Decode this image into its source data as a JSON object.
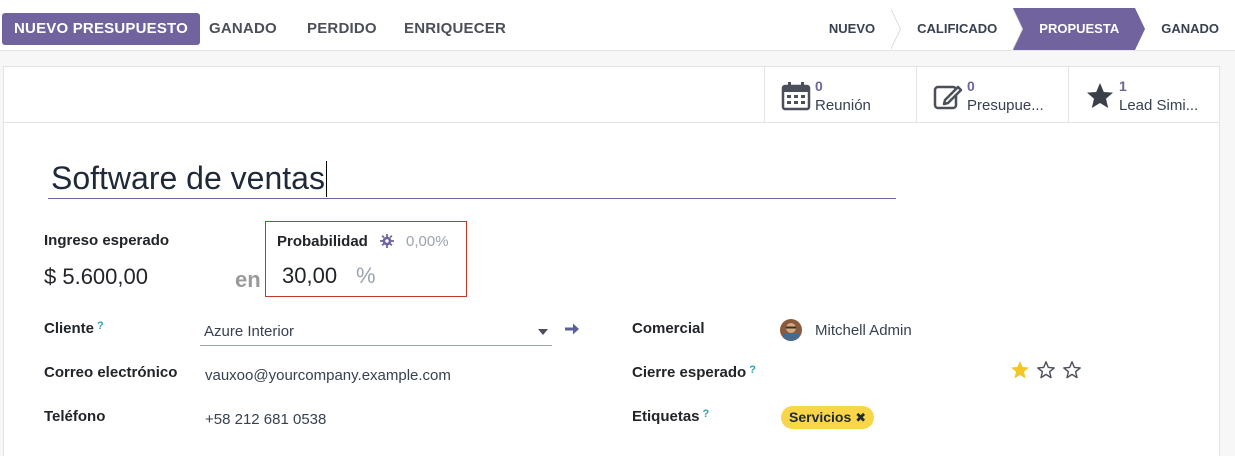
{
  "actions": {
    "new_quote": "NUEVO PRESUPUESTO",
    "won": "GANADO",
    "lost": "PERDIDO",
    "enrich": "ENRIQUECER"
  },
  "stages": [
    {
      "label": "NUEVO",
      "active": false
    },
    {
      "label": "CALIFICADO",
      "active": false
    },
    {
      "label": "PROPUESTA",
      "active": true
    },
    {
      "label": "GANADO",
      "active": false
    }
  ],
  "smart_buttons": [
    {
      "count": "0",
      "label": "Reunión",
      "icon": "calendar-icon"
    },
    {
      "count": "0",
      "label": "Presupue...",
      "icon": "edit-icon"
    },
    {
      "count": "1",
      "label": "Lead Simi...",
      "icon": "star-icon"
    }
  ],
  "lead": {
    "name": "Software de ventas",
    "expected_revenue_label": "Ingreso esperado",
    "expected_revenue": "$ 5.600,00",
    "in_label": "en",
    "probability_label": "Probabilidad",
    "auto_probability": "0,00%",
    "probability": "30,00",
    "percent": "%"
  },
  "fields": {
    "customer_label": "Cliente",
    "customer": "Azure Interior",
    "email_label": "Correo electrónico",
    "email": "vauxoo@yourcompany.example.com",
    "phone_label": "Teléfono",
    "phone": "+58 212 681 0538",
    "salesperson_label": "Comercial",
    "salesperson": "Mitchell Admin",
    "closing_label": "Cierre esperado",
    "priority_stars": 1,
    "tags_label": "Etiquetas",
    "tag": "Servicios",
    "help_mark": "?"
  },
  "colors": {
    "brand": "#71639e",
    "highlight_box": "#c0392b",
    "tag": "#f9d548",
    "star_filled": "#f3c623"
  }
}
